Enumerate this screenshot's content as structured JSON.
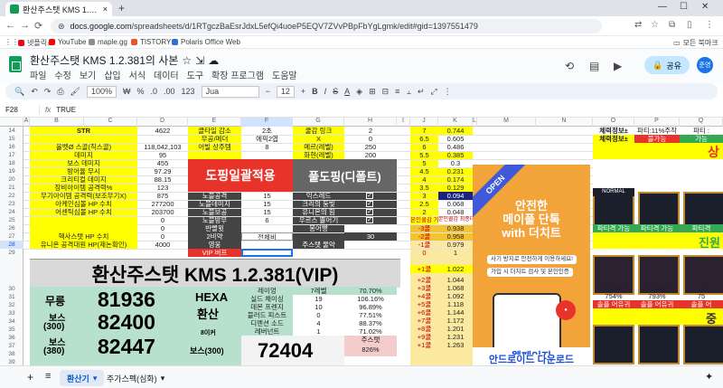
{
  "browser": {
    "tab_title": "환산주스탯 KMS 1.2.381의 사본",
    "url_host": "docs.google.com",
    "url_path": "/spreadsheets/d/1RTgczBaEsrJdxL5efQi4uoeP5EQV7ZVvPBpFbYgLgmk/edit#gid=1397551479",
    "bookmarks": [
      {
        "label": "넷플릭스",
        "color": "#e50914"
      },
      {
        "label": "YouTube",
        "color": "#ff0000"
      },
      {
        "label": "maple.gg",
        "color": "#8e8e8e"
      },
      {
        "label": "TISTORY",
        "color": "#eb531f"
      },
      {
        "label": "Polaris Office Web",
        "color": "#2a72d5"
      }
    ],
    "all_bookmarks": "모든 북마크"
  },
  "doc": {
    "title": "환산주스탯 KMS 1.2.381의 사본",
    "menu": [
      "파일",
      "수정",
      "보기",
      "삽입",
      "서식",
      "데이터",
      "도구",
      "확장 프로그램",
      "도움말"
    ],
    "share_label": "공유",
    "avatar_text": "준영"
  },
  "toolbar": {
    "zoom": "100%",
    "currency": "₩",
    "percent": "%",
    "dec1": ".0",
    "dec2": ".00",
    "numfmt": "123",
    "font": "Jua",
    "font_size": "12",
    "bold": "B",
    "italic": "I",
    "strike": "S",
    "text_color": "A"
  },
  "formula_bar": {
    "cell_ref": "F28",
    "fx": "fx",
    "value": "TRUE"
  },
  "columns": [
    "A",
    "B",
    "C",
    "D",
    "E",
    "F",
    "G",
    "H",
    "I",
    "J",
    "K",
    "L",
    "M",
    "N",
    "O",
    "P",
    "Q"
  ],
  "rows": [
    "14",
    "15",
    "16",
    "17",
    "18",
    "19",
    "20",
    "21",
    "22",
    "23",
    "24",
    "25",
    "26",
    "27",
    "28",
    "29",
    "30",
    "31",
    "32",
    "33",
    "34",
    "35",
    "36",
    "37",
    "38",
    "39",
    "40"
  ],
  "active_row": "28",
  "sheet": {
    "row14": {
      "b": "STR",
      "d": "4622",
      "e": "클타일 감소",
      "f": "2초",
      "g": "쿨감 링크",
      "h": "2",
      "j": "7",
      "k": "0.744"
    },
    "row15": {
      "e": "무공/메더",
      "f": "에픽2엽",
      "g": "X",
      "h": "0",
      "j": "6.5",
      "k": "0.605"
    },
    "row16": {
      "b": "올벳Ø 스골(직스골)",
      "d": "118,042,103",
      "e": "어빌 상주템",
      "f": "8",
      "g": "메르(레벨)",
      "h": "250",
      "j": "6",
      "k": "0.486"
    },
    "row17": {
      "b": "데미지",
      "d": "95",
      "g": "화현(레벨)",
      "h": "200",
      "j": "5.5",
      "k": "0.385"
    },
    "row18": {
      "b": "보스 데미지",
      "d": "455",
      "j": "5",
      "k": "0.3"
    },
    "row19": {
      "b": "방어율 무시",
      "d": "97.29",
      "j": "4.5",
      "k": "0.231"
    },
    "row20": {
      "b": "크리티컬 데미지",
      "d": "88.15",
      "j": "4",
      "k": "0.174"
    },
    "row21": {
      "b": "장비아이템 공격력%",
      "d": "123",
      "e": "노블공격",
      "f": "15",
      "g": "익스레드",
      "j": "3.5",
      "k": "0.129"
    },
    "row22": {
      "b": "무기아이템 공격력(보조무기X)",
      "d": "875",
      "e": "노블데미지",
      "f": "15",
      "g": "크리의 둥빛",
      "j": "3",
      "k": "0.094"
    },
    "row23": {
      "b": "아케인심볼 HP 수치",
      "d": "277200",
      "e": "노블보공",
      "f": "15",
      "g": "유니온의 힘",
      "j": "2.5",
      "k": "0.068"
    },
    "row24": {
      "b": "어센틱심볼 HP 수치",
      "d": "203700",
      "e": "노블방무",
      "f": "6",
      "g": "우르스 뿔어기",
      "j": "2",
      "k": "0.048"
    },
    "row25": {
      "d": "0",
      "e": "반빨윗",
      "j": "본인쿨감 기준++",
      "k": "본인쿨감 최종데미지"
    },
    "row26": {
      "d": "0",
      "e": "2비약",
      "f": "전체비",
      "g": "봉어빵",
      "j": "-3쿨",
      "k": "0.938"
    },
    "row27": {
      "b": "헥사스탯 HP 수치",
      "d": "0",
      "e": "영웅",
      "g": "주스탯 물약",
      "h": "30",
      "j": "-2쿨",
      "k": "0.958"
    },
    "row28": {
      "b": "유니온 공격대원 HP(제논확인)",
      "d": "4000",
      "e": "VIP 버프",
      "j": "-1쿨",
      "k": "0.979"
    },
    "row29": {
      "j": "0",
      "k": "1"
    },
    "row30": {
      "j": "+1쿨",
      "k": "1.022"
    },
    "row31": {
      "j": "+2쿨",
      "k": "1.044"
    },
    "row32": {
      "j": "+3쿨",
      "k": "1.068"
    },
    "row33": {
      "j": "+4쿨",
      "k": "1.092"
    },
    "row34": {
      "j": "+5쿨",
      "k": "1.118"
    },
    "row35": {
      "j": "+6쿨",
      "k": "1.144"
    },
    "row36": {
      "j": "+7쿨",
      "k": "1.172"
    },
    "row37": {
      "j": "+8쿨",
      "k": "1.201"
    },
    "row38": {
      "j": "+9쿨",
      "k": "1.231"
    },
    "row39": {
      "j": "+1쿨",
      "k": "1.263"
    }
  },
  "banners": {
    "red": "도핑일괄적용",
    "gray": "풀도핑(디폴트)",
    "big_title": "환산주스탯 KMS 1.2.381(VIP)"
  },
  "summary": {
    "label_mureung": "무릉",
    "val_mureung": "81936",
    "label_boss300_a": "보스",
    "label_boss300_b": "(300)",
    "val_boss300": "82400",
    "label_boss380_a": "보스",
    "label_boss380_b": "(380)",
    "val_boss380": "82447",
    "hexa_a": "HEXA",
    "hexa_b": "환산",
    "eight_king": "8이커",
    "boss300_label": "보스(300)",
    "hexa_val": "72404"
  },
  "level_table": {
    "header": [
      "레이엉",
      "7레벨",
      "70.70%"
    ],
    "rows": [
      [
        "실드 체이싱",
        "19",
        "106.16%"
      ],
      [
        "데몬 프렌지",
        "10",
        "96.89%"
      ],
      [
        "블러드 피스트",
        "0",
        "77.51%"
      ],
      [
        "디멘션 소드",
        "4",
        "88.37%"
      ],
      [
        "레버넌트",
        "1",
        "71.02%"
      ]
    ],
    "mainstat_label": "주스탯",
    "mainstat_val": "826%"
  },
  "ad": {
    "corner": "OPEN",
    "headline_1": "안전한",
    "headline_2": "메이플 단톡",
    "headline_3": "with 더치트",
    "box1": "사기 방지로 안전하게 이용하세요!",
    "box2": "가입 시 더치트 검사 및 본인인증",
    "footer_1": "웹페이지",
    "footer_2": "안드로이드 다운로드"
  },
  "right_panel": {
    "col_o": [
      "체력정보±",
      "체력정보±"
    ],
    "col_p": [
      "파티:11%주작",
      "불가능"
    ],
    "col_q": [
      "파티 :",
      "가능"
    ],
    "num1": "64922",
    "p_num": "1월 : 72570",
    "p_num2": "2월 : 74180",
    "q_num": "1월 : 7",
    "party": "파티 : 178%",
    "pct1": "76%",
    "pct2": "131%",
    "party_row": [
      "파티격 가능",
      "파티격 가능",
      "파티격"
    ],
    "num2": "72299",
    "num3": "72299",
    "num4": "7",
    "pct3": "754%",
    "pct4": "793%",
    "pct5": "75",
    "last_row": [
      "솔플 어유귀",
      "솔플 어유귀",
      "솔플 어"
    ],
    "side_a": "상",
    "side_b": "진원",
    "side_c": "중",
    "nickname": "NORMAL"
  },
  "bottom": {
    "sheet1": "환산기",
    "sheet2": "주가스펙(심화)"
  }
}
